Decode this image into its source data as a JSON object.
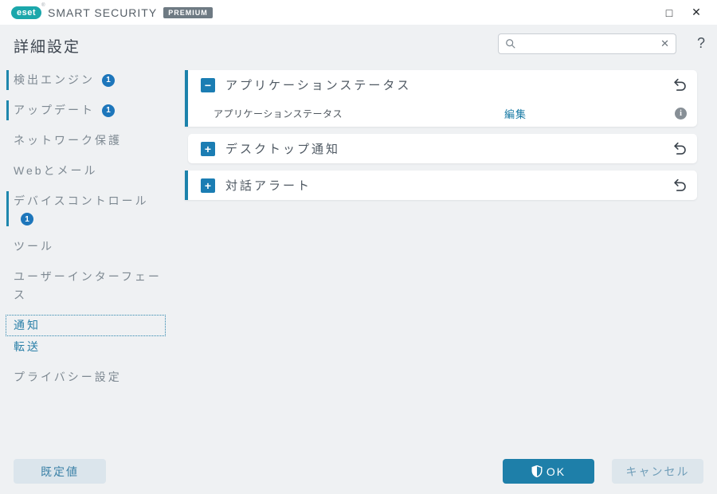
{
  "window": {
    "brand": {
      "logo_text": "eset",
      "reg_mark": "®",
      "product_name": "SMART SECURITY",
      "tier_badge": "PREMIUM"
    },
    "controls": {
      "maximize_glyph": "□",
      "close_glyph": "✕"
    }
  },
  "header": {
    "title": "詳細設定",
    "search_value": "",
    "search_placeholder": "",
    "clear_glyph": "✕",
    "help_label": "?"
  },
  "sidebar": {
    "items": [
      {
        "label": "検出エンジン",
        "badge": "1"
      },
      {
        "label": "アップデート",
        "badge": "1"
      },
      {
        "label": "ネットワーク保護",
        "badge": ""
      },
      {
        "label": "Webとメール",
        "badge": ""
      },
      {
        "label": "デバイスコントロール",
        "badge": "1"
      },
      {
        "label": "ツール",
        "badge": ""
      },
      {
        "label": "ユーザーインターフェース",
        "badge": ""
      },
      {
        "label": "通知",
        "badge": ""
      },
      {
        "label": "転送",
        "badge": ""
      },
      {
        "label": "プライバシー設定",
        "badge": ""
      }
    ]
  },
  "main": {
    "sections": [
      {
        "title": "アプリケーションステータス",
        "toggle_glyph": "−",
        "expanded": true,
        "rows": [
          {
            "label": "アプリケーションステータス",
            "action": "編集",
            "info_glyph": "i"
          }
        ]
      },
      {
        "title": "デスクトップ通知",
        "toggle_glyph": "+",
        "expanded": false
      },
      {
        "title": "対話アラート",
        "toggle_glyph": "+",
        "expanded": false
      }
    ]
  },
  "footer": {
    "default_label": "既定値",
    "ok_label": "OK",
    "cancel_label": "キャンセル"
  },
  "colors": {
    "accent_teal": "#1c82ab",
    "logo_teal": "#1ba7ab",
    "badge_blue": "#1d76bb",
    "link_blue": "#1779a4",
    "primary_button": "#1e7fa9",
    "background": "#eff1f3"
  }
}
